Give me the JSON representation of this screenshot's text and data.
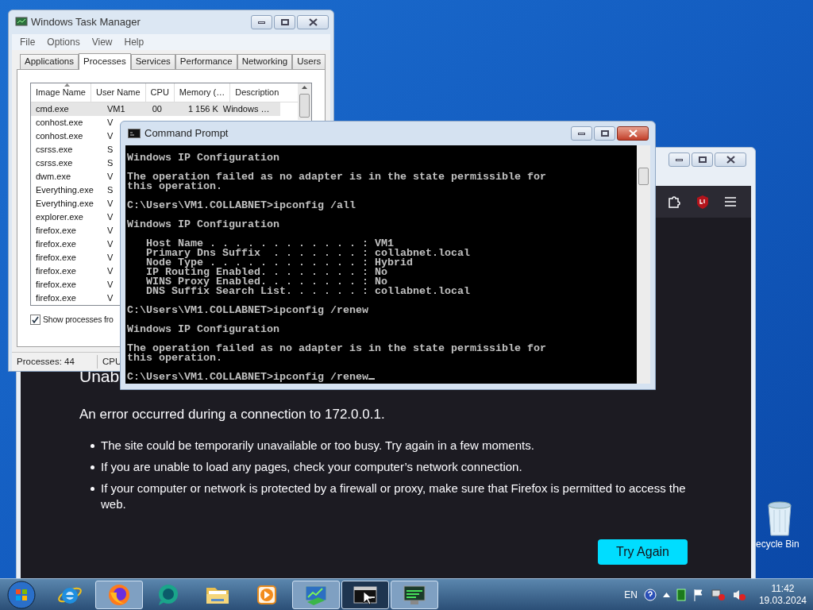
{
  "task_manager": {
    "title": "Windows Task Manager",
    "menu": [
      "File",
      "Options",
      "View",
      "Help"
    ],
    "tabs": [
      {
        "label": "Applications",
        "selected": false
      },
      {
        "label": "Processes",
        "selected": true
      },
      {
        "label": "Services",
        "selected": false
      },
      {
        "label": "Performance",
        "selected": false
      },
      {
        "label": "Networking",
        "selected": false
      },
      {
        "label": "Users",
        "selected": false
      }
    ],
    "columns": [
      "Image Name",
      "User Name",
      "CPU",
      "Memory (…",
      "Description"
    ],
    "rows": [
      {
        "image": "cmd.exe",
        "user": "VM1",
        "cpu": "00",
        "memory": "1 156 K",
        "description": "Windows …",
        "selected": true
      },
      {
        "image": "conhost.exe",
        "user": "V",
        "selected": false
      },
      {
        "image": "conhost.exe",
        "user": "V",
        "selected": false
      },
      {
        "image": "csrss.exe",
        "user": "S",
        "selected": false
      },
      {
        "image": "csrss.exe",
        "user": "S",
        "selected": false
      },
      {
        "image": "dwm.exe",
        "user": "V",
        "selected": false
      },
      {
        "image": "Everything.exe",
        "user": "S",
        "selected": false
      },
      {
        "image": "Everything.exe",
        "user": "V",
        "selected": false
      },
      {
        "image": "explorer.exe",
        "user": "V",
        "selected": false
      },
      {
        "image": "firefox.exe",
        "user": "V",
        "selected": false
      },
      {
        "image": "firefox.exe",
        "user": "V",
        "selected": false
      },
      {
        "image": "firefox.exe",
        "user": "V",
        "selected": false
      },
      {
        "image": "firefox.exe",
        "user": "V",
        "selected": false
      },
      {
        "image": "firefox.exe",
        "user": "V",
        "selected": false
      },
      {
        "image": "firefox.exe",
        "user": "V",
        "selected": false
      }
    ],
    "show_all": {
      "label": "Show processes fro",
      "checked": true
    },
    "status": [
      "Processes: 44",
      "CPU"
    ]
  },
  "console": {
    "title": "Command Prompt",
    "blocks": [
      [
        "Windows IP Configuration"
      ],
      [
        "The operation failed as no adapter is in the state permissible for",
        "this operation."
      ],
      [
        "C:\\Users\\VM1.COLLABNET>ipconfig /all"
      ],
      [
        "Windows IP Configuration"
      ],
      [
        "   Host Name . . . . . . . . . . . . : VM1",
        "   Primary Dns Suffix  . . . . . . . : collabnet.local",
        "   Node Type . . . . . . . . . . . . : Hybrid",
        "   IP Routing Enabled. . . . . . . . : No",
        "   WINS Proxy Enabled. . . . . . . . : No",
        "   DNS Suffix Search List. . . . . . : collabnet.local"
      ],
      [
        "C:\\Users\\VM1.COLLABNET>ipconfig /renew"
      ],
      [
        "Windows IP Configuration"
      ],
      [
        "The operation failed as no adapter is in the state permissible for",
        "this operation."
      ],
      [
        "C:\\Users\\VM1.COLLABNET>ipconfig /renew"
      ]
    ]
  },
  "browser": {
    "heading": "Unab",
    "message": "An error occurred during a connection to 172.0.0.1.",
    "bullets": [
      "The site could be temporarily unavailable or too busy. Try again in a few moments.",
      "If you are unable to load any pages, check your computer’s network connection.",
      "If your computer or network is protected by a firewall or proxy, make sure that Firefox is permitted to access the web."
    ],
    "button": "Try Again"
  },
  "desktop_icons": [
    {
      "label": "ecycle Bin"
    }
  ],
  "taskbar": {
    "apps": [
      {
        "kind": "ie",
        "open": false,
        "selected": false
      },
      {
        "kind": "firefox",
        "open": true,
        "selected": false
      },
      {
        "kind": "chat",
        "open": false,
        "selected": false
      },
      {
        "kind": "folder",
        "open": false,
        "selected": false
      },
      {
        "kind": "media",
        "open": false,
        "selected": false
      },
      {
        "kind": "taskmgr",
        "open": true,
        "selected": false
      },
      {
        "kind": "console",
        "open": true,
        "selected": true
      },
      {
        "kind": "network",
        "open": true,
        "selected": false
      }
    ],
    "language": "EN",
    "time": "11:42",
    "date": "19.03.2024"
  }
}
